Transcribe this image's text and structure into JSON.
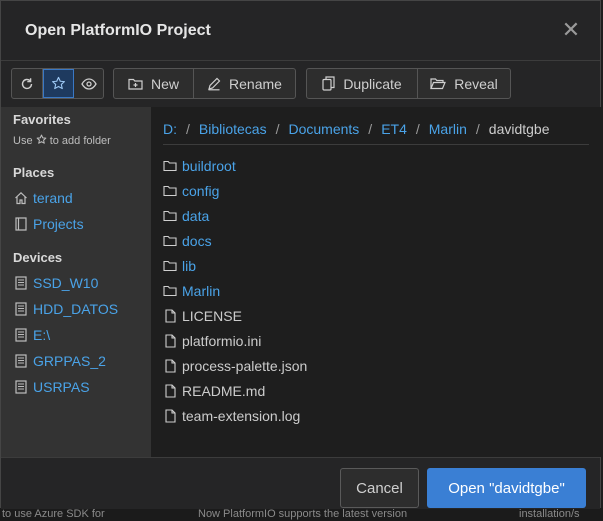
{
  "dialog": {
    "title": "Open PlatformIO Project",
    "close_glyph": "✕"
  },
  "toolbar": {
    "refresh_icon": "refresh-icon",
    "favorite_icon": "star-icon",
    "hidden_icon": "eye-icon",
    "new_label": "New",
    "rename_label": "Rename",
    "duplicate_label": "Duplicate",
    "reveal_label": "Reveal"
  },
  "sidebar": {
    "favorites_heading": "Favorites",
    "favorites_hint_prefix": "Use",
    "favorites_hint_suffix": "to add folder",
    "places_heading": "Places",
    "places": [
      {
        "label": "terand",
        "icon": "home-icon"
      },
      {
        "label": "Projects",
        "icon": "project-icon"
      }
    ],
    "devices_heading": "Devices",
    "devices": [
      {
        "label": "SSD_W10",
        "icon": "drive-icon"
      },
      {
        "label": "HDD_DATOS",
        "icon": "drive-icon"
      },
      {
        "label": "E:\\",
        "icon": "drive-icon"
      },
      {
        "label": "GRPPAS_2",
        "icon": "drive-icon"
      },
      {
        "label": "USRPAS",
        "icon": "drive-icon"
      }
    ]
  },
  "breadcrumb": {
    "parts": [
      "D:",
      "Bibliotecas",
      "Documents",
      "ET4",
      "Marlin",
      "davidtgbe"
    ],
    "separator": "/"
  },
  "files": [
    {
      "name": "buildroot",
      "type": "folder"
    },
    {
      "name": "config",
      "type": "folder"
    },
    {
      "name": "data",
      "type": "folder"
    },
    {
      "name": "docs",
      "type": "folder"
    },
    {
      "name": "lib",
      "type": "folder"
    },
    {
      "name": "Marlin",
      "type": "folder"
    },
    {
      "name": "LICENSE",
      "type": "file"
    },
    {
      "name": "platformio.ini",
      "type": "file"
    },
    {
      "name": "process-palette.json",
      "type": "file"
    },
    {
      "name": "README.md",
      "type": "file"
    },
    {
      "name": "team-extension.log",
      "type": "file"
    }
  ],
  "footer": {
    "cancel_label": "Cancel",
    "open_label": "Open \"davidtgbe\""
  },
  "background": {
    "left_text": "to use Azure SDK for",
    "mid_text": "Now PlatformIO supports the latest version",
    "right_text": "installation/s"
  },
  "colors": {
    "accent": "#3a7fd4",
    "link": "#4aa3e8",
    "dialog_bg": "#252526",
    "sidebar_bg": "#333333",
    "list_bg": "#1e1e1e"
  }
}
